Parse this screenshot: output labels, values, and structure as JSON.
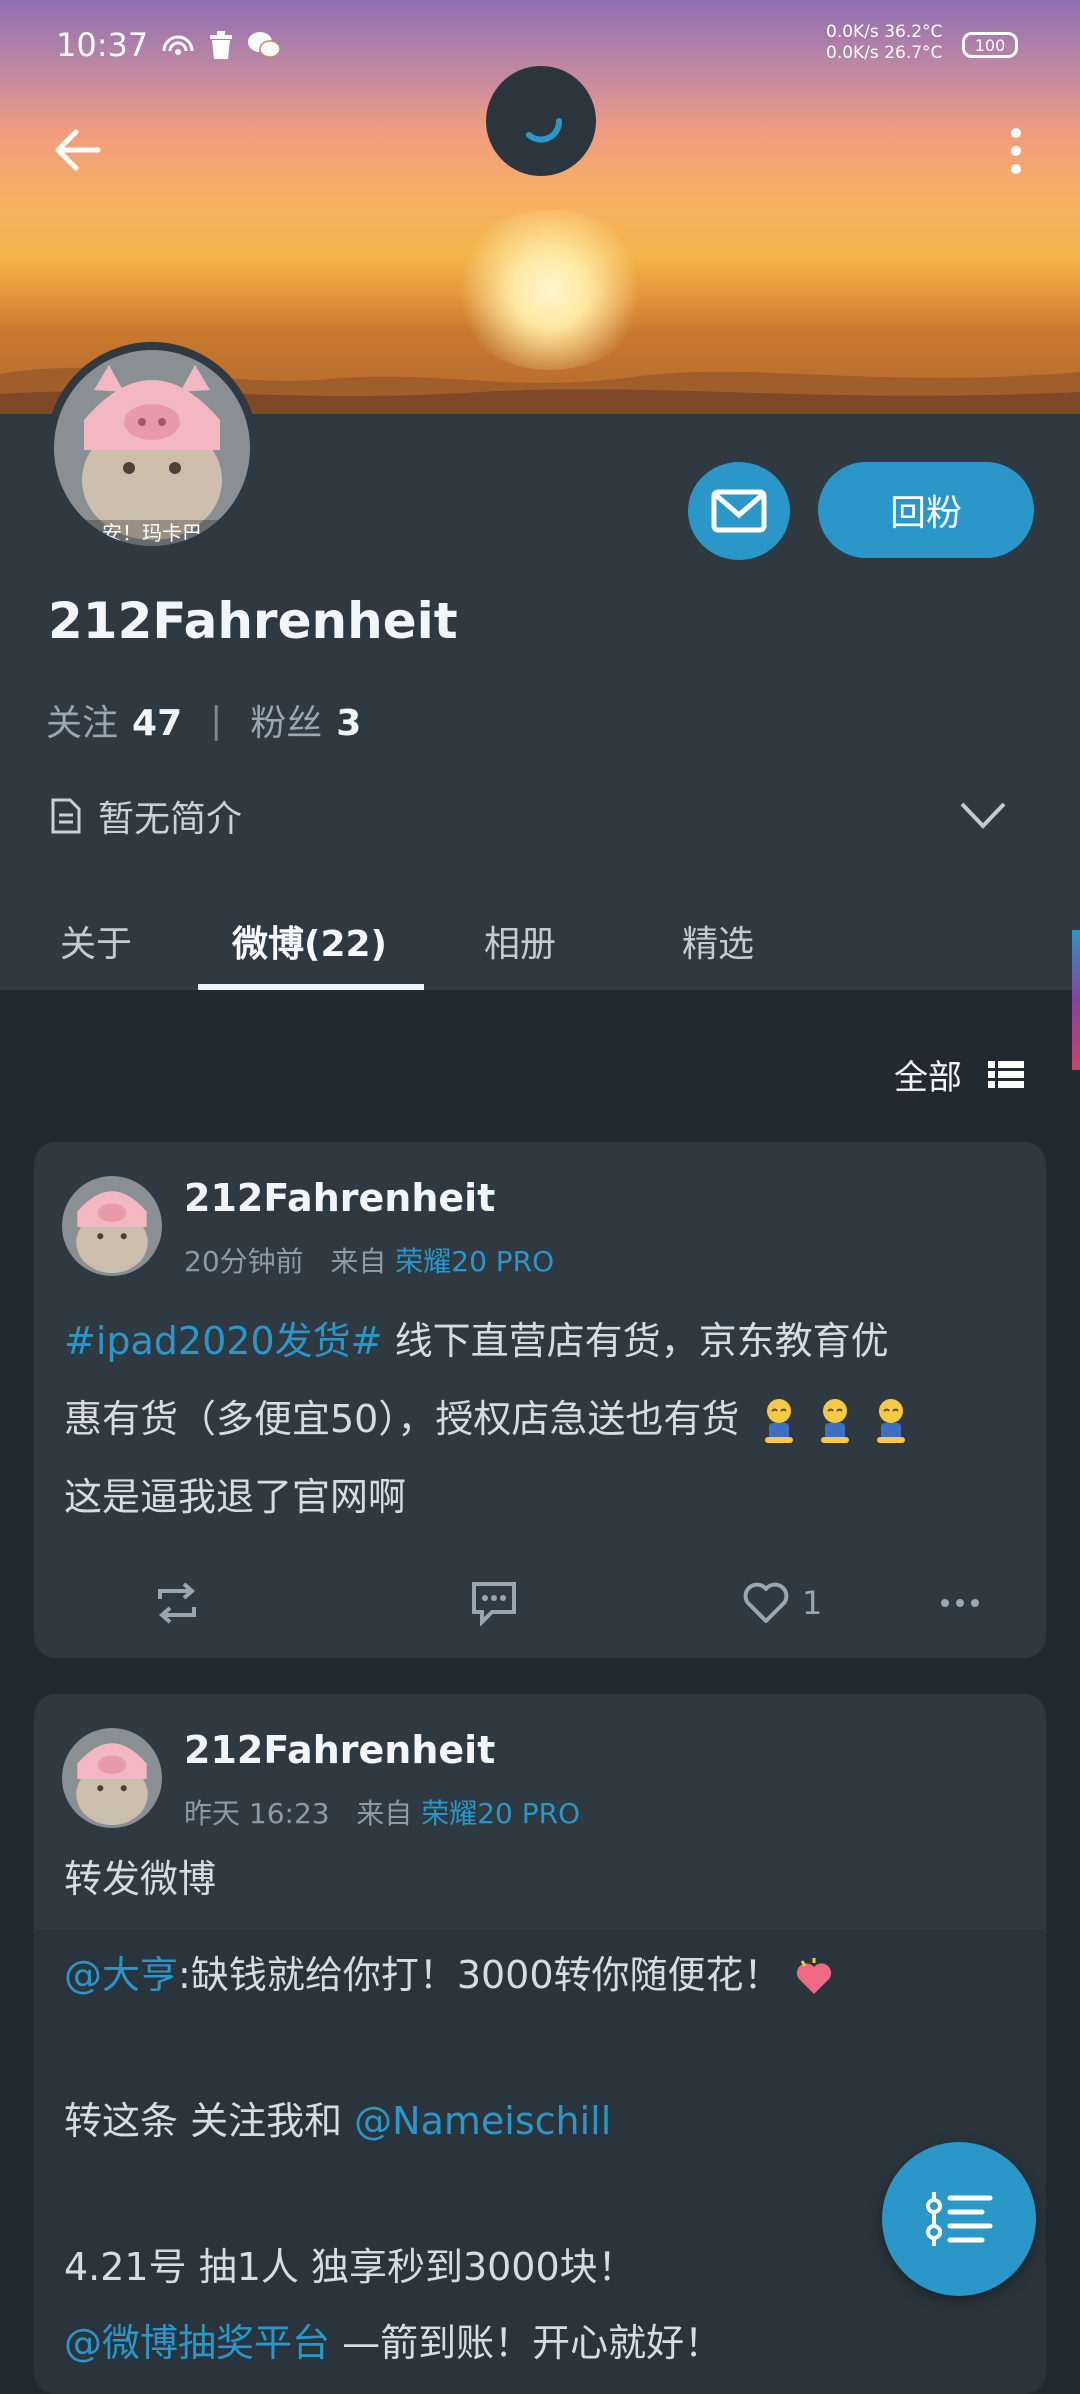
{
  "status_bar": {
    "time": "10:37",
    "net_up": "0.0K/s",
    "net_down": "0.0K/s",
    "temp1": "36.2°C",
    "temp2": "26.7°C",
    "battery": "100",
    "icons": [
      "hotspot-icon",
      "trash-icon",
      "wechat-icon"
    ]
  },
  "header": {
    "back_icon": "arrow-left-icon",
    "menu_icon": "more-vertical-icon",
    "loading_icon": "loading-spinner-icon"
  },
  "profile": {
    "username": "212Fahrenheit",
    "avatar_caption": "安！玛卡巴",
    "following_label": "关注",
    "following_count": "47",
    "separator": "|",
    "followers_label": "粉丝",
    "followers_count": "3",
    "bio": "暂无简介",
    "message_icon": "mail-icon",
    "follow_back_label": "回粉"
  },
  "tabs": [
    {
      "label": "关于",
      "active": false
    },
    {
      "label": "微博(22)",
      "active": true
    },
    {
      "label": "相册",
      "active": false
    },
    {
      "label": "精选",
      "active": false
    }
  ],
  "filter": {
    "label": "全部",
    "icon": "list-icon"
  },
  "posts": [
    {
      "author": "212Fahrenheit",
      "time": "20分钟前",
      "from_label": "来自",
      "source": "荣耀20 PRO",
      "hashtag": "#ipad2020发货#",
      "text_line1": " 线下直营店有货，京东教育优",
      "text_line2": "惠有货（多便宜50），授权店急送也有货",
      "text_line3": "这是逼我退了官网啊",
      "likes": "1"
    },
    {
      "author": "212Fahrenheit",
      "time": "昨天 16:23",
      "from_label": "来自",
      "source": "荣耀20 PRO",
      "text": "转发微博",
      "repost": {
        "mention1": "@大亨",
        "line1": ":缺钱就给你打！3000转你随便花！",
        "line2_prefix": "转这条 关注我和 ",
        "mention2": "@Nameischill",
        "line3": "4.21号 抽1人 独享秒到3000块！",
        "mention3": "@微博抽奖平台",
        "line4_suffix": " —箭到账！开心就好！"
      }
    }
  ],
  "fab_icon": "timeline-list-icon",
  "colors": {
    "accent": "#2a97c8",
    "background": "#222a31",
    "card": "#2e3942"
  }
}
